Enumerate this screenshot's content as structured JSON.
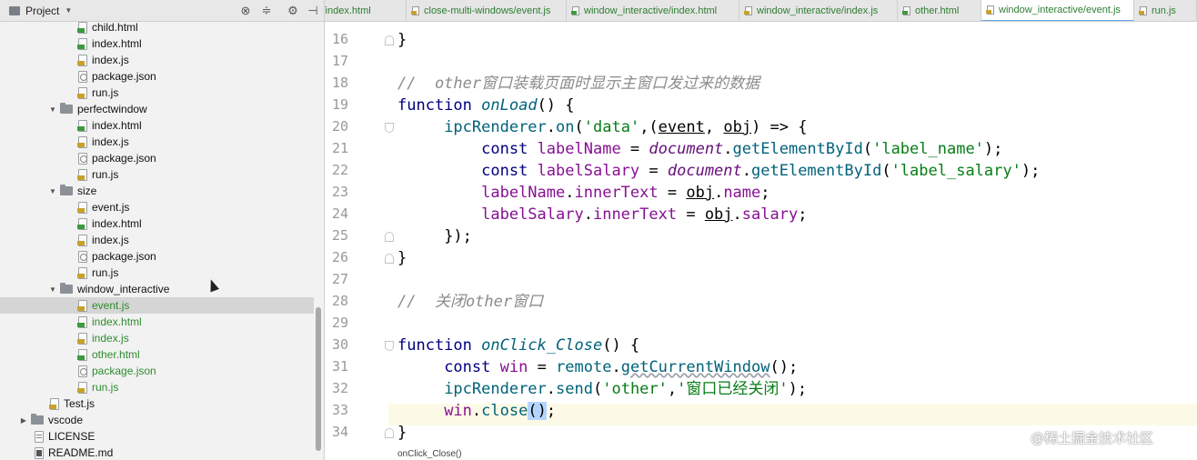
{
  "project": {
    "title": "Project",
    "tree": [
      {
        "label": "child.html",
        "type": "html",
        "indent": 2
      },
      {
        "label": "index.html",
        "type": "html",
        "indent": 2
      },
      {
        "label": "index.js",
        "type": "js",
        "indent": 2
      },
      {
        "label": "package.json",
        "type": "json",
        "indent": 2
      },
      {
        "label": "run.js",
        "type": "js",
        "indent": 2
      },
      {
        "label": "perfectwindow",
        "type": "folder",
        "indent": 1
      },
      {
        "label": "index.html",
        "type": "html",
        "indent": 2
      },
      {
        "label": "index.js",
        "type": "js",
        "indent": 2
      },
      {
        "label": "package.json",
        "type": "json",
        "indent": 2
      },
      {
        "label": "run.js",
        "type": "js",
        "indent": 2
      },
      {
        "label": "size",
        "type": "folder",
        "indent": 1
      },
      {
        "label": "event.js",
        "type": "js",
        "indent": 2
      },
      {
        "label": "index.html",
        "type": "html",
        "indent": 2
      },
      {
        "label": "index.js",
        "type": "js",
        "indent": 2
      },
      {
        "label": "package.json",
        "type": "json",
        "indent": 2
      },
      {
        "label": "run.js",
        "type": "js",
        "indent": 2
      },
      {
        "label": "window_interactive",
        "type": "folder",
        "indent": 1
      },
      {
        "label": "event.js",
        "type": "js",
        "indent": 2,
        "selected": true,
        "green": true
      },
      {
        "label": "index.html",
        "type": "html",
        "indent": 2,
        "green": true
      },
      {
        "label": "index.js",
        "type": "js",
        "indent": 2,
        "green": true
      },
      {
        "label": "other.html",
        "type": "html",
        "indent": 2,
        "green": true
      },
      {
        "label": "package.json",
        "type": "json",
        "indent": 2,
        "green": true
      },
      {
        "label": "run.js",
        "type": "js",
        "indent": 2,
        "green": true
      },
      {
        "label": "Test.js",
        "type": "js",
        "indent": 1
      },
      {
        "label": "vscode",
        "type": "folder-collapsed",
        "indent": 0
      },
      {
        "label": "LICENSE",
        "type": "txt",
        "indent": 0
      },
      {
        "label": "README.md",
        "type": "md",
        "indent": 0
      }
    ]
  },
  "tabs": [
    {
      "label": "s/index.html",
      "type": "html"
    },
    {
      "label": "close-multi-windows/event.js",
      "type": "js"
    },
    {
      "label": "window_interactive/index.html",
      "type": "html"
    },
    {
      "label": "window_interactive/index.js",
      "type": "js"
    },
    {
      "label": "other.html",
      "type": "html"
    },
    {
      "label": "window_interactive/event.js",
      "type": "js",
      "active": true
    },
    {
      "label": "run.js",
      "type": "js"
    }
  ],
  "editor": {
    "line_numbers": [
      "16",
      "17",
      "18",
      "19",
      "20",
      "21",
      "22",
      "23",
      "24",
      "25",
      "26",
      "27",
      "28",
      "29",
      "30",
      "31",
      "32",
      "33",
      "34"
    ],
    "current_line": "33",
    "breadcrumb": "onClick_Close()",
    "watermark": "@稀土掘金技术社区",
    "code": {
      "l16": "}",
      "l18_comment": "//  other窗口装载页面时显示主窗口发过来的数据",
      "l19_kw": "function",
      "l19_fn": "onLoad",
      "l19_rest": "() {",
      "l20_obj": "ipcRenderer",
      "l20_method": "on",
      "l20_str": "'data'",
      "l20_p1": "event",
      "l20_p2": "obj",
      "l20_rest": ") => {",
      "l21_kw": "const",
      "l21_var": "labelName",
      "l21_doc": "document",
      "l21_method": "getElementById",
      "l21_str": "'label_name'",
      "l22_kw": "const",
      "l22_var": "labelSalary",
      "l22_doc": "document",
      "l22_method": "getElementById",
      "l22_str": "'label_salary'",
      "l23_var": "labelName",
      "l23_prop": "innerText",
      "l23_obj": "obj",
      "l23_field": "name",
      "l24_var": "labelSalary",
      "l24_prop": "innerText",
      "l24_obj": "obj",
      "l24_field": "salary",
      "l25": "});",
      "l26": "}",
      "l28_comment": "//  关闭other窗口",
      "l30_kw": "function",
      "l30_fn": "onClick_Close",
      "l30_rest": "() {",
      "l31_kw": "const",
      "l31_var": "win",
      "l31_obj": "remote",
      "l31_method": "getCurrentWindow",
      "l32_obj": "ipcRenderer",
      "l32_method": "send",
      "l32_str1": "'other'",
      "l32_str2": "'窗口已经关闭'",
      "l33_var": "win",
      "l33_method": "close",
      "l34": "}"
    }
  }
}
